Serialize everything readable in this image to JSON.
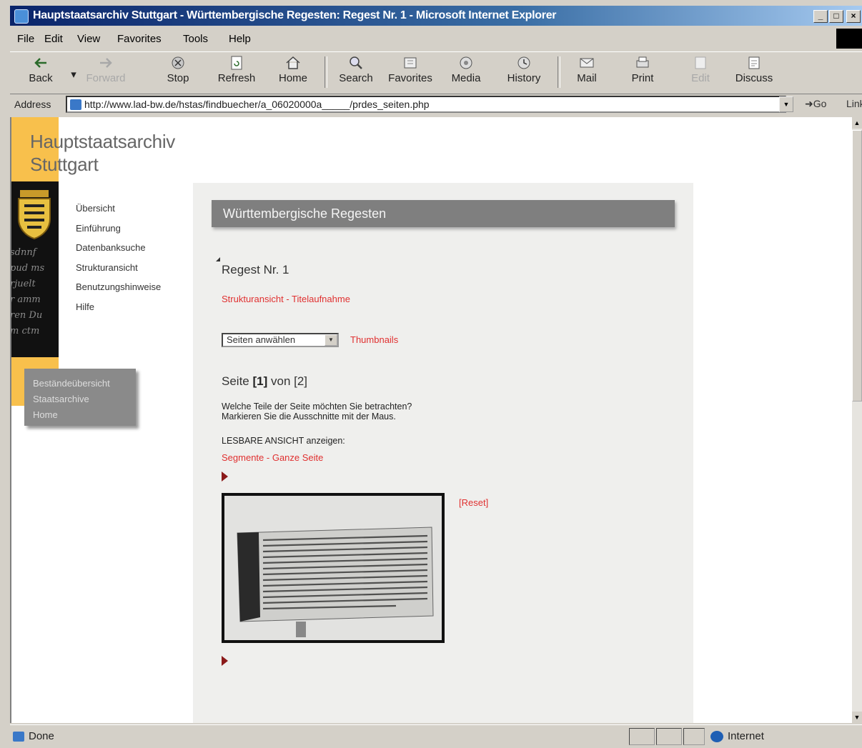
{
  "window": {
    "title": "Hauptstaatsarchiv Stuttgart - Württembergische Regesten: Regest Nr. 1 - Microsoft Internet Explorer",
    "controls": [
      "_",
      "□",
      "×"
    ]
  },
  "menu": [
    "File",
    "Edit",
    "View",
    "Favorites",
    "Tools",
    "Help"
  ],
  "toolbar": [
    {
      "label": "Back",
      "icon": "back-arrow-icon"
    },
    {
      "label": "Forward",
      "icon": "forward-arrow-icon",
      "disabled": true
    },
    {
      "label": "Stop",
      "icon": "stop-icon"
    },
    {
      "label": "Refresh",
      "icon": "refresh-icon"
    },
    {
      "label": "Home",
      "icon": "home-icon"
    },
    {
      "label": "Search",
      "icon": "search-icon"
    },
    {
      "label": "Favorites",
      "icon": "favorites-icon"
    },
    {
      "label": "Media",
      "icon": "media-icon"
    },
    {
      "label": "History",
      "icon": "history-icon"
    },
    {
      "label": "Mail",
      "icon": "mail-icon"
    },
    {
      "label": "Print",
      "icon": "print-icon"
    },
    {
      "label": "Edit",
      "icon": "edit-icon",
      "disabled": true
    },
    {
      "label": "Discuss",
      "icon": "discuss-icon"
    }
  ],
  "address": {
    "label": "Address",
    "url": "http://www.lad-bw.de/hstas/findbuecher/a_06020000a_____/prdes_seiten.php",
    "go": "Go",
    "links": "Links"
  },
  "site": {
    "title_line1": "Hauptstaatsarchiv",
    "title_line2": "Stuttgart",
    "nav": [
      "Übersicht",
      "Einführung",
      "Datenbanksuche",
      "Strukturansicht",
      "Benutzungshinweise",
      "Hilfe"
    ],
    "gray_menu": [
      "Beständeübersicht",
      "Staatsarchive",
      "Home"
    ]
  },
  "content": {
    "header": "Württembergische Regesten",
    "regest_title": "Regest Nr. 1",
    "link_struktur": "Strukturansicht",
    "link_sep": " - ",
    "link_titel": "Titelaufnahme",
    "select_value": "Seiten anwählen",
    "thumbnails": "Thumbnails",
    "seite_prefix": "Seite ",
    "seite_current": "[1]",
    "seite_mid": " von ",
    "seite_total": "[2]",
    "question_line1": "Welche Teile der Seite möchten Sie betrachten?",
    "question_line2": "Markieren Sie die Ausschnitte mit der Maus.",
    "lesbar": "LESBARE ANSICHT anzeigen:",
    "link_segmente": "Segmente",
    "link_ganze": "Ganze Seite",
    "reset": "[Reset]"
  },
  "status": {
    "text": "Done",
    "zone": "Internet"
  },
  "colors": {
    "accent_yellow": "#f8c04c",
    "link_red": "#e03030",
    "header_gray": "#7f7f7f"
  }
}
